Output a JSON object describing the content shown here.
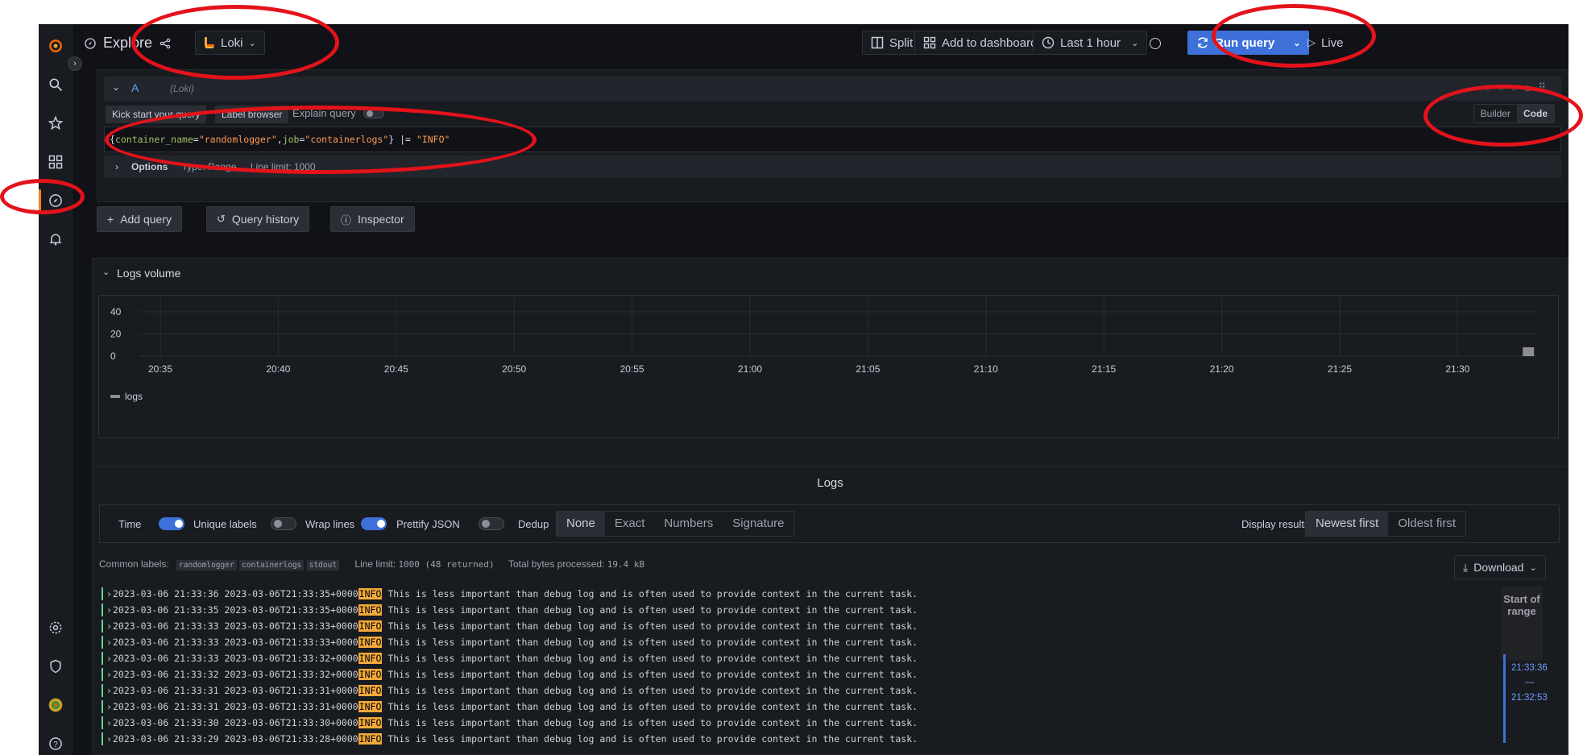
{
  "topbar": {
    "title": "Explore",
    "datasource": "Loki",
    "split": "Split",
    "add_to_dashboard": "Add to dashboard",
    "time_range": "Last 1 hour",
    "run_query": "Run query",
    "live": "Live"
  },
  "query": {
    "ref_id": "A",
    "datasource_hint": "(Loki)",
    "kick_start": "Kick start your query",
    "label_browser": "Label browser",
    "explain_query": "Explain query",
    "mode_builder": "Builder",
    "mode_code": "Code",
    "parts": [
      "{",
      "container_name",
      "=",
      "\"randomlogger\"",
      ",",
      "job",
      "=",
      "\"containerlogs\"",
      "}",
      " |= ",
      "\"INFO\""
    ],
    "options_label": "Options",
    "options_type": "Type: Range",
    "options_limit": "Line limit: 1000"
  },
  "actions": {
    "add_query": "Add query",
    "query_history": "Query history",
    "inspector": "Inspector"
  },
  "logs_volume": {
    "title": "Logs volume",
    "legend": "logs"
  },
  "chart_data": {
    "type": "bar",
    "title": "Logs volume",
    "x": [
      "20:35",
      "20:40",
      "20:45",
      "20:50",
      "20:55",
      "21:00",
      "21:05",
      "21:10",
      "21:15",
      "21:20",
      "21:25",
      "21:30"
    ],
    "yticks": [
      "40",
      "20",
      "0"
    ],
    "ylim": [
      0,
      40
    ],
    "series": [
      {
        "name": "logs",
        "values": [
          {
            "x": "21:33",
            "y": 8
          }
        ]
      }
    ],
    "grid": true,
    "legend_placement": "bottom-left"
  },
  "logs": {
    "title": "Logs",
    "time": "Time",
    "unique_labels": "Unique labels",
    "wrap_lines": "Wrap lines",
    "prettify_json": "Prettify JSON",
    "dedup": "Dedup",
    "dedup_options": [
      "None",
      "Exact",
      "Numbers",
      "Signature"
    ],
    "display_results": "Display results",
    "newest_first": "Newest first",
    "oldest_first": "Oldest first",
    "common_labels": "Common labels:",
    "labels": [
      "randomlogger",
      "containerlogs",
      "stdout"
    ],
    "line_limit_label": "Line limit:",
    "line_limit_value": "1000 (48 returned)",
    "bytes_label": "Total bytes processed:",
    "bytes_value": "19.4 kB",
    "download": "Download",
    "start_of_range": "Start of range",
    "range_top": "21:33:36",
    "range_dash": "—",
    "range_bottom": "21:32:53",
    "message": "This is less important than debug log and is often used to provide context in the current task.",
    "level": "INFO",
    "lines": [
      {
        "time": "2023-03-06 21:33:36",
        "ts": "2023-03-06T21:33:35+0000"
      },
      {
        "time": "2023-03-06 21:33:35",
        "ts": "2023-03-06T21:33:35+0000"
      },
      {
        "time": "2023-03-06 21:33:33",
        "ts": "2023-03-06T21:33:33+0000"
      },
      {
        "time": "2023-03-06 21:33:33",
        "ts": "2023-03-06T21:33:33+0000"
      },
      {
        "time": "2023-03-06 21:33:33",
        "ts": "2023-03-06T21:33:32+0000"
      },
      {
        "time": "2023-03-06 21:33:32",
        "ts": "2023-03-06T21:33:32+0000"
      },
      {
        "time": "2023-03-06 21:33:31",
        "ts": "2023-03-06T21:33:31+0000"
      },
      {
        "time": "2023-03-06 21:33:31",
        "ts": "2023-03-06T21:33:31+0000"
      },
      {
        "time": "2023-03-06 21:33:30",
        "ts": "2023-03-06T21:33:30+0000"
      },
      {
        "time": "2023-03-06 21:33:29",
        "ts": "2023-03-06T21:33:28+0000"
      }
    ]
  },
  "colors": {
    "accent": "#3d71d9",
    "info": "#f2a93b",
    "annotation": "#e3121b"
  }
}
